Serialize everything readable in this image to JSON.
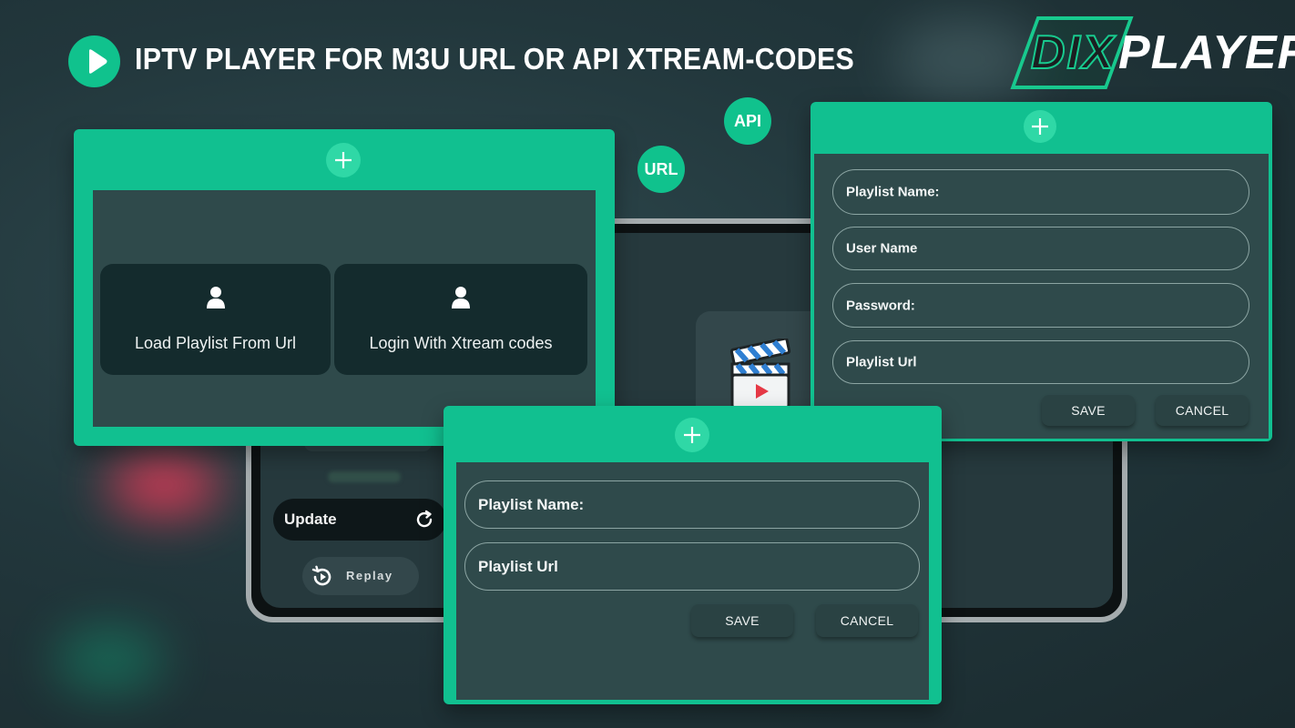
{
  "header": {
    "title": "IPTV PLAYER FOR M3U URL OR API XTREAM-CODES",
    "logo_part1": "DIX",
    "logo_part2": "PLAYER"
  },
  "badges": {
    "api": "API",
    "url": "URL"
  },
  "choice_dialog": {
    "options": [
      {
        "label": "Load Playlist From Url",
        "icon": "user-icon"
      },
      {
        "label": "Login With Xtream codes",
        "icon": "user-icon"
      }
    ]
  },
  "xtream_dialog": {
    "fields": [
      "Playlist Name:",
      "User Name",
      "Password:",
      "Playlist Url"
    ],
    "save_label": "SAVE",
    "cancel_label": "CANCEL"
  },
  "url_dialog": {
    "fields": [
      "Playlist Name:",
      "Playlist Url"
    ],
    "save_label": "SAVE",
    "cancel_label": "CANCEL"
  },
  "phone": {
    "update_label": "Update",
    "replay_label": "Replay"
  },
  "colors": {
    "accent": "#11c090",
    "dialog_body": "#2f4a4b",
    "background": "#22373c"
  }
}
